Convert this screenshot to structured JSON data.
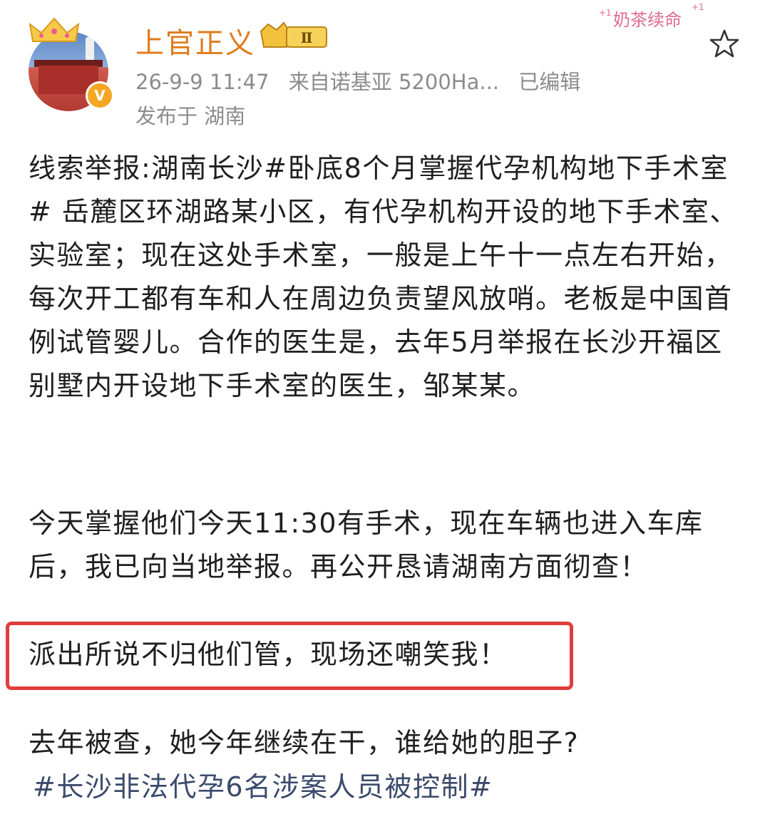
{
  "post": {
    "author": "上官正义",
    "level": "Ⅱ",
    "verified_mark": "V",
    "timestamp": "26-9-9 11:47",
    "source": "来自诺基亚 5200Ha...",
    "edited": "已编辑",
    "location": "发布于 湖南",
    "paragraphs": {
      "p1": "线索举报:湖南长沙#卧底8个月掌握代孕机构地下手术室# 岳麓区环湖路某小区，有代孕机构开设的地下手术室、实验室；现在这处手术室，一般是上午十一点左右开始，每次开工都有车和人在周边负责望风放哨。老板是中国首例试管婴儿。合作的医生是，去年5月举报在长沙开福区别墅内开设地下手术室的医生，邹某某。",
      "p2": "今天掌握他们今天11:30有手术，现在车辆也进入车库后，我已向当地举报。再公开恳请湖南方面彻查！",
      "p3": "派出所说不归他们管，现场还嘲笑我！",
      "p4": "去年被查，她今年继续在干，谁给她的胆子?"
    },
    "hashtag": "#长沙非法代孕6名涉案人员被控制#"
  },
  "decoration": {
    "text": "奶茶续命"
  },
  "colors": {
    "name": "#e07b1b",
    "highlight_border": "#e13d3d",
    "meta": "#8c8c8c"
  },
  "icons": [
    "crown-icon",
    "verified-icon",
    "star-icon",
    "level-badge-icon"
  ]
}
